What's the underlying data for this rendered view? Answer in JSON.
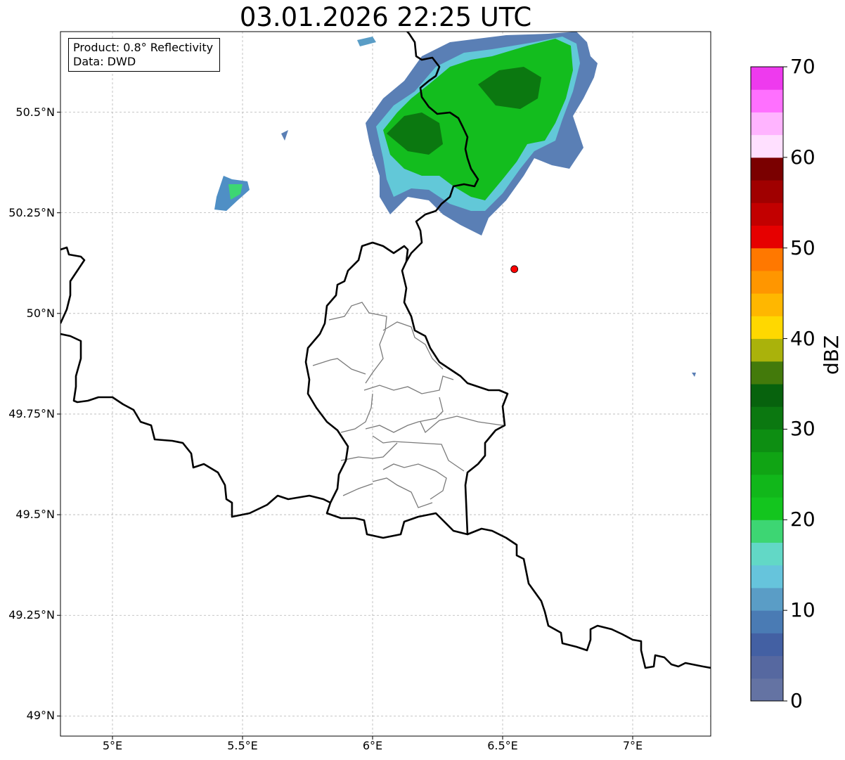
{
  "title": "03.01.2026 22:25 UTC",
  "info": {
    "product": "Product: 0.8° Reflectivity",
    "data": "Data: DWD"
  },
  "axes": {
    "lat_ticks": [
      {
        "value": 50.5,
        "label": "50.5°N"
      },
      {
        "value": 50.25,
        "label": "50.25°N"
      },
      {
        "value": 50.0,
        "label": "50°N"
      },
      {
        "value": 49.75,
        "label": "49.75°N"
      },
      {
        "value": 49.5,
        "label": "49.5°N"
      },
      {
        "value": 49.25,
        "label": "49.25°N"
      },
      {
        "value": 49.0,
        "label": "49°N"
      }
    ],
    "lon_ticks": [
      {
        "value": 5.0,
        "label": "5°E"
      },
      {
        "value": 5.5,
        "label": "5.5°E"
      },
      {
        "value": 6.0,
        "label": "6°E"
      },
      {
        "value": 6.5,
        "label": "6.5°E"
      },
      {
        "value": 7.0,
        "label": "7°E"
      }
    ],
    "lon_range": [
      4.8,
      7.3
    ],
    "lat_range": [
      48.95,
      50.7
    ],
    "grid": true
  },
  "colorbar": {
    "unit": "dBZ",
    "range": [
      0,
      70
    ],
    "tick_labels": [
      "0",
      "10",
      "20",
      "30",
      "40",
      "50",
      "60",
      "70"
    ],
    "colors": [
      "#6473a3",
      "#5668a0",
      "#4360a3",
      "#4a7bb4",
      "#5a9dc6",
      "#66c4dc",
      "#62d8c6",
      "#3dd673",
      "#13c51e",
      "#11b71a",
      "#10a414",
      "#0d8e12",
      "#0b7810",
      "#07620d",
      "#437a0b",
      "#aab20b",
      "#ffd800",
      "#ffb700",
      "#ff9600",
      "#ff7800",
      "#e60000",
      "#c20000",
      "#a00000",
      "#7a0000",
      "#ffe0ff",
      "#ffb4ff",
      "#ff70ff",
      "#ee3aee"
    ]
  },
  "marker": {
    "lon": 6.545,
    "lat": 50.11,
    "color": "#ff0000"
  }
}
